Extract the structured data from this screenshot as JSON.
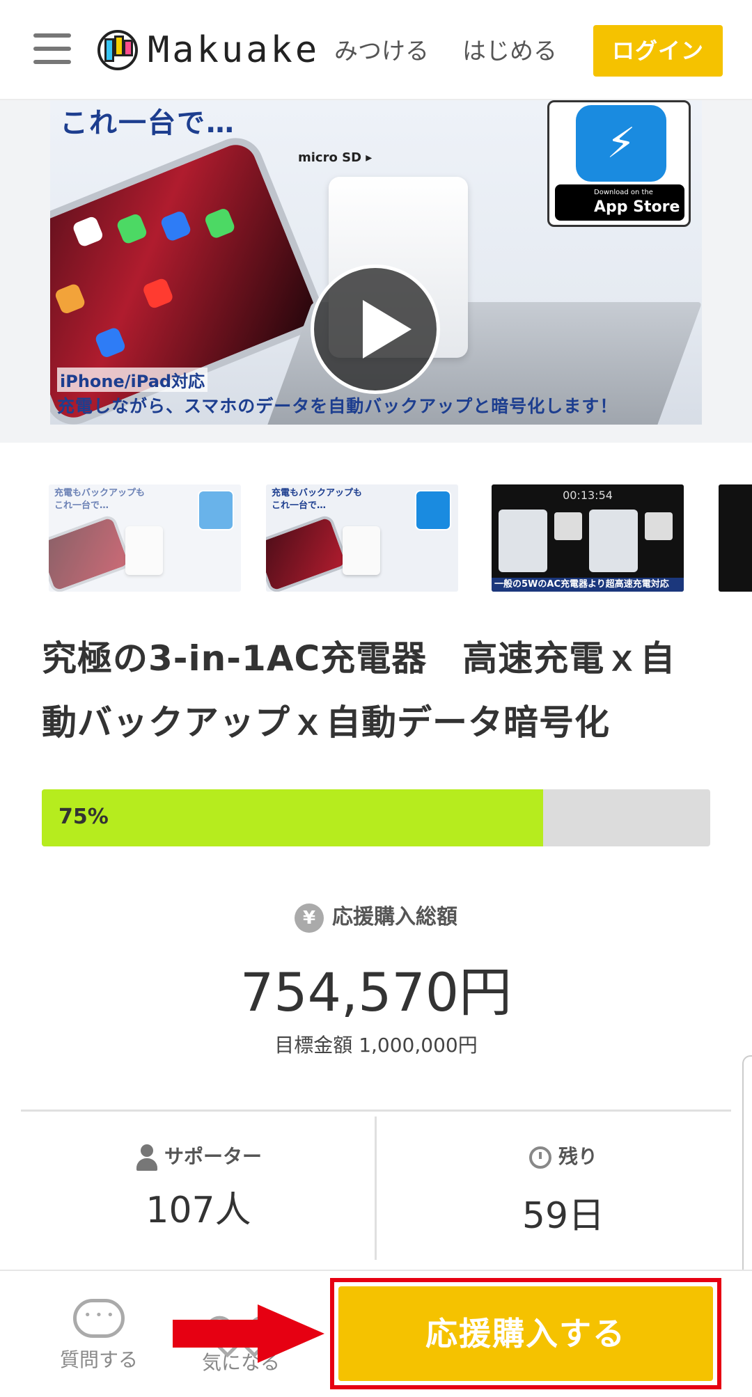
{
  "header": {
    "brand": "Makuake",
    "nav": [
      "みつける",
      "はじめる"
    ],
    "login_label": "ログイン"
  },
  "hero": {
    "headline": "これ一台で…",
    "sd_label": "micro SD ▸",
    "appstore_small": "Download on the",
    "appstore_big": "App Store",
    "caption1": "iPhone/iPad対応",
    "caption2": "充電しながら、スマホのデータを自動バックアップと暗号化します！"
  },
  "thumbnails": [
    {
      "text": "充電もバックアップも\nこれ一台で…",
      "bar": ""
    },
    {
      "text": "充電もバックアップも\nこれ一台で…",
      "bar": ""
    },
    {
      "time": "00:13:54",
      "bar": "一般の5WのAC充電器より超高速充電対応"
    }
  ],
  "project": {
    "title": "究極の3-in-1AC充電器　高速充電ｘ自動バックアップｘ自動データ暗号化",
    "progress_label": "75%",
    "progress_fraction": 0.75,
    "amount_label": "応援購入総額",
    "amount": "754,570円",
    "goal": "目標金額 1,000,000円",
    "supporters_label": "サポーター",
    "supporters_value": "107人",
    "remaining_label": "残り",
    "remaining_value": "59日"
  },
  "bottom_bar": {
    "question_label": "質問する",
    "favorite_label": "気になる",
    "cta_label": "応援購入する"
  },
  "icons": {
    "yen": "¥",
    "apple": ""
  },
  "colors": {
    "brand_yellow": "#f5c200",
    "progress_green": "#b6ec1e",
    "annotation_red": "#e60012"
  }
}
